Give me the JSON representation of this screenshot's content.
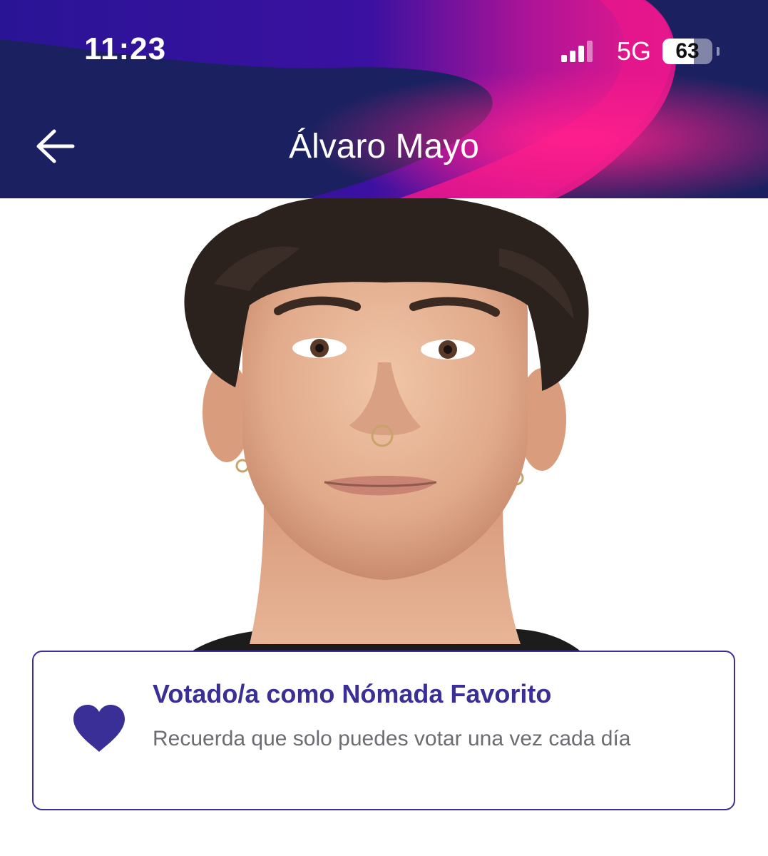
{
  "status_bar": {
    "time": "11:23",
    "network": "5G",
    "battery": "63",
    "battery_level_percent": 63,
    "signal_bars_active": 3,
    "signal_bars_total": 4
  },
  "header": {
    "title": "Álvaro Mayo",
    "back_icon": "arrow-left-icon"
  },
  "colors": {
    "header_dark": "#1b2160",
    "header_purple": "#2a1496",
    "header_magenta": "#e6168c",
    "accent": "#3a2f96",
    "subtitle_gray": "#6c6c72"
  },
  "vote_card": {
    "icon": "heart-icon",
    "title": "Votado/a como Nómada Favorito",
    "subtitle": "Recuerda que solo puedes votar una vez cada día"
  }
}
